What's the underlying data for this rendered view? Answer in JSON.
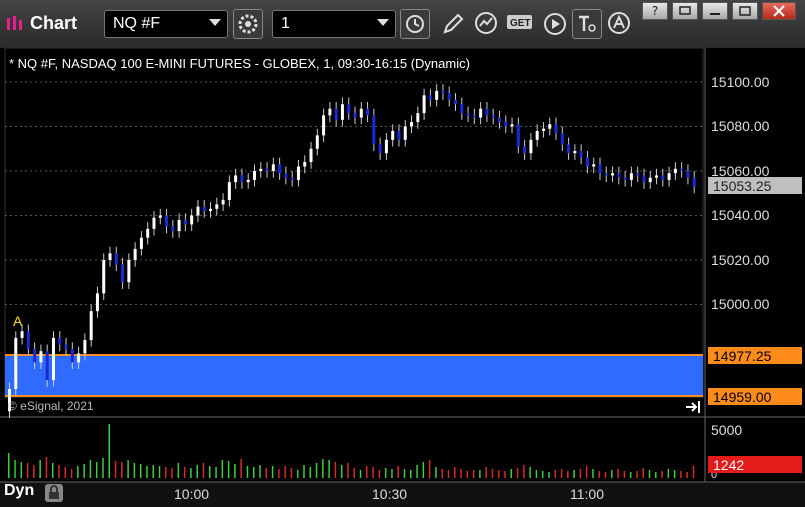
{
  "window": {
    "title": "Chart",
    "symbol": "NQ #F",
    "interval": "1",
    "controls": [
      "?",
      "minimize",
      "maximize",
      "close"
    ]
  },
  "toolbar": {
    "icons": [
      "settings-icon",
      "clock-icon",
      "pencil-icon",
      "study-icon",
      "get-icon",
      "play-icon",
      "text-icon",
      "alert-icon"
    ],
    "get_label": "GET"
  },
  "chart": {
    "title": "* NQ #F, NASDAQ 100 E-MINI FUTURES - GLOBEX, 1, 09:30-16:15 (Dynamic)",
    "copyright": "© eSignal, 2021",
    "marker": "A",
    "dyn_label": "Dyn",
    "time_labels": [
      "10:00",
      "10:30",
      "11:00"
    ],
    "price_labels": [
      "15100.00",
      "15080.00",
      "15060.00",
      "15040.00",
      "15020.00",
      "15000.00"
    ],
    "last_price": "15053.25",
    "range_high": "14977.25",
    "range_low": "14959.00",
    "volume_label": "5000",
    "volume_zero": "0",
    "last_volume": "1242",
    "colors": {
      "background": "#000000",
      "up_candle": "#ffffff",
      "down_candle": "#1a2bd6",
      "range_fill": "#2f6bff",
      "range_line": "#ff8c1a",
      "tag_orange": "#ff8c1a",
      "tag_red": "#e41b1b",
      "tag_gray": "#bfbfbf",
      "volume_up": "#3ccf3c",
      "volume_down": "#d92a2a"
    }
  },
  "chart_data": {
    "type": "candlestick",
    "ylim": [
      14955,
      15115
    ],
    "yticks": [
      15000,
      15020,
      15040,
      15060,
      15080,
      15100
    ],
    "xlabels": [
      "10:00",
      "10:30",
      "11:00"
    ],
    "close": [
      14962,
      14985,
      14988,
      14980,
      14974,
      14979,
      14966,
      14985,
      14982,
      14980,
      14974,
      14978,
      14984,
      14997,
      15005,
      15020,
      15023,
      15018,
      15010,
      15020,
      15025,
      15030,
      15034,
      15039,
      15040,
      15035,
      15033,
      15038,
      15036,
      15040,
      15044,
      15042,
      15043,
      15045,
      15047,
      15055,
      15058,
      15055,
      15056,
      15060,
      15061,
      15060,
      15063,
      15059,
      15057,
      15056,
      15062,
      15064,
      15070,
      15076,
      15085,
      15088,
      15083,
      15090,
      15086,
      15084,
      15088,
      15085,
      15072,
      15068,
      15074,
      15078,
      15074,
      15080,
      15082,
      15086,
      15094,
      15092,
      15096,
      15095,
      15092,
      15090,
      15086,
      15085,
      15084,
      15088,
      15085,
      15084,
      15082,
      15080,
      15081,
      15071,
      15068,
      15074,
      15078,
      15079,
      15081,
      15077,
      15072,
      15068,
      15069,
      15066,
      15062,
      15063,
      15059,
      15058,
      15059,
      15057,
      15056,
      15059,
      15058,
      15055,
      15057,
      15058,
      15056,
      15059,
      15061,
      15060,
      15057,
      15053
    ],
    "volume_ylim": [
      0,
      5000
    ],
    "volume": [
      2500,
      1800,
      1600,
      1500,
      1300,
      1800,
      2100,
      1500,
      1300,
      1100,
      900,
      1200,
      1400,
      1800,
      1600,
      2000,
      5400,
      1700,
      1600,
      1800,
      1500,
      1400,
      1200,
      1300,
      1200,
      1100,
      1000,
      1500,
      1100,
      1000,
      1300,
      1500,
      1200,
      1100,
      1800,
      1700,
      1400,
      1900,
      1200,
      1100,
      1300,
      1000,
      1200,
      900,
      1200,
      1000,
      800,
      1300,
      1100,
      1500,
      1900,
      1800,
      1600,
      1300,
      1500,
      1000,
      800,
      1200,
      1100,
      800,
      1000,
      900,
      1200,
      900,
      800,
      1300,
      1600,
      1800,
      1100,
      900,
      800,
      1100,
      900,
      700,
      800,
      800,
      1100,
      900,
      800,
      700,
      900,
      1000,
      1300,
      1100,
      800,
      700,
      600,
      800,
      900,
      700,
      800,
      900,
      1200,
      900,
      700,
      600,
      800,
      900,
      700,
      600,
      700,
      1000,
      800,
      600,
      700,
      900,
      800,
      700,
      600,
      1242
    ]
  }
}
